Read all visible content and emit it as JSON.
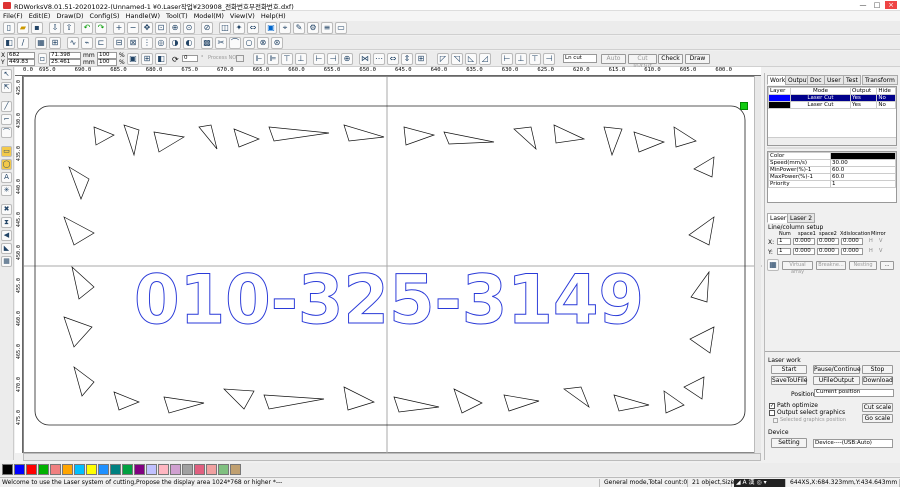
{
  "window": {
    "title": "RDWorksV8.01.51-20201022-(Unnamed-1 ¥0.Laser작업¥230908_전화번호부전화번호.dxf)",
    "min": "—",
    "max": "□",
    "close": "×"
  },
  "menu": [
    "File(F)",
    "Edit(E)",
    "Draw(D)",
    "Config(S)",
    "Handle(W)",
    "Tool(T)",
    "Model(M)",
    "View(V)",
    "Help(H)"
  ],
  "toolbar2": {
    "x_value": "682",
    "y_value": "449.83",
    "w_value": "71.398",
    "h_value": "25.461",
    "w_unit": "mm",
    "h_unit": "mm",
    "w_pct": "100",
    "h_pct": "100",
    "w_pct_unit": "%",
    "h_pct_unit": "%",
    "x_label": "X",
    "y_label": "Y",
    "rotation": "0",
    "process_no_label": "Process NO.",
    "cut_mode": "Ln cut",
    "auto_label": "Auto",
    "cut_inout_label": "Cut In/Out",
    "check_label": "Check",
    "draw_label": "Draw"
  },
  "ruler": {
    "h_ticks": [
      "0.0",
      "695.0",
      "690.0",
      "685.0",
      "680.0",
      "675.0",
      "670.0",
      "665.0",
      "660.0",
      "655.0",
      "650.0",
      "645.0",
      "640.0",
      "635.0",
      "630.0",
      "625.0",
      "620.0",
      "615.0",
      "610.0",
      "605.0",
      "600.0"
    ],
    "v_ticks": [
      "425.0",
      "430.0",
      "435.0",
      "440.0",
      "445.0",
      "450.0",
      "455.0",
      "460.0",
      "465.0",
      "470.0",
      "475.0"
    ]
  },
  "canvas": {
    "phone_text": "010-325-3149",
    "text_color": "#2a3ad8"
  },
  "right_panel": {
    "tabs": [
      "Work",
      "Output",
      "Doc",
      "User",
      "Test",
      "Transform"
    ],
    "layer_headers": [
      "Layer",
      "Mode",
      "Output",
      "Hide"
    ],
    "layer_rows": [
      {
        "mode": "Laser Cut",
        "output": "Yes",
        "hide": "No",
        "color": "#0000ff",
        "selected": true
      },
      {
        "mode": "Laser Cut",
        "output": "Yes",
        "hide": "No",
        "color": "#000000",
        "selected": false
      }
    ],
    "props": [
      {
        "label": "Color",
        "value": ""
      },
      {
        "label": "Speed(mm/s)",
        "value": "30.00"
      },
      {
        "label": "MinPower(%)-1",
        "value": "60.0"
      },
      {
        "label": "MaxPower(%)-1",
        "value": "60.0"
      },
      {
        "label": "Priority",
        "value": "1"
      }
    ],
    "layer_tabs": [
      "Laser 1",
      "Laser 2"
    ],
    "array_title": "Line/column setup",
    "array_headers": [
      "Num",
      "space1",
      "space2",
      "Xdislocation",
      "Mirror"
    ],
    "array_x": {
      "label": "X:",
      "num": "1",
      "s1": "0.000",
      "s2": "0.000",
      "dis": "0.000",
      "h": "H",
      "v": "V"
    },
    "array_y": {
      "label": "Y:",
      "num": "1",
      "s1": "0.000",
      "s2": "0.000",
      "dis": "0.000",
      "h": "H",
      "v": "V"
    },
    "array_buttons": [
      "Virtual array",
      "Breakne...",
      "Nesting",
      "..."
    ],
    "laser_work_title": "Laser work",
    "start_label": "Start",
    "pause_label": "Pause/Continue",
    "stop_label": "Stop",
    "save_label": "SaveToUFile",
    "ufile_label": "UFileOutput",
    "download_label": "Download",
    "position_label": "Position:",
    "position_value": "Current position",
    "path_optimize": "Path optimize",
    "output_select": "Output select graphics",
    "selected_graphics": "Selected graphics position",
    "cut_scale": "Cut scale",
    "go_scale": "Go scale",
    "device_title": "Device",
    "setting_label": "Setting",
    "device_value": "Device----(USB:Auto)"
  },
  "palette": [
    "#000000",
    "#0000ff",
    "#ff0000",
    "#00b000",
    "#f08080",
    "#ffa500",
    "#00bfff",
    "#ffff00",
    "#1e90ff",
    "#008080",
    "#00a040",
    "#800080",
    "#c0c0ff",
    "#ffb6c1",
    "#d0a0d0",
    "#a0a0a0",
    "#e06080",
    "#f0a0a0",
    "#80c080",
    "#c0a070"
  ],
  "status": {
    "message": "Welcome to use the Laser system of cutting,Propose the display area 1024*768 or higher *---",
    "mode": "General mode,Total count:0",
    "objects": "21 object,Size:X",
    "coords": "644XS,X:684.323mm,Y:434.643mm"
  }
}
